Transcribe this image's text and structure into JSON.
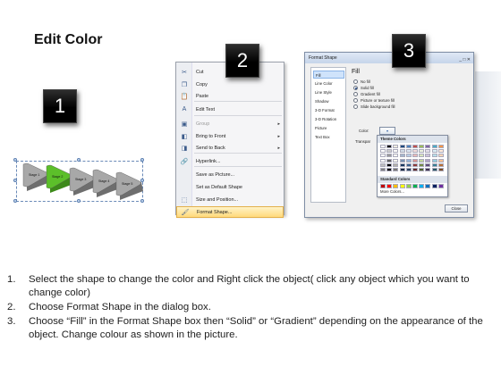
{
  "title": "Edit Color",
  "badges": [
    "1",
    "2",
    "3"
  ],
  "stages": {
    "labels": [
      "Stage 1",
      "Stage 2",
      "Stage 3",
      "Stage 4",
      "Stage 5"
    ],
    "selected_color": "#5cbf2a",
    "base_color": "#a8a8a8"
  },
  "context_menu": {
    "items": [
      {
        "icon": "scissors-icon",
        "glyph": "✂",
        "label": "Cut"
      },
      {
        "icon": "copy-icon",
        "glyph": "❐",
        "label": "Copy"
      },
      {
        "icon": "paste-icon",
        "glyph": "📋",
        "label": "Paste"
      },
      {
        "icon": "edit-text-icon",
        "glyph": "A",
        "label": "Edit Text"
      },
      {
        "icon": "group-icon",
        "glyph": "▣",
        "label": "Group"
      },
      {
        "icon": "bring-to-front-icon",
        "glyph": "◧",
        "label": "Bring to Front"
      },
      {
        "icon": "send-to-back-icon",
        "glyph": "◨",
        "label": "Send to Back"
      },
      {
        "icon": "hyperlink-icon",
        "glyph": "🔗",
        "label": "Hyperlink..."
      },
      {
        "icon": "save-as-picture-icon",
        "glyph": "",
        "label": "Save as Picture..."
      },
      {
        "icon": "default-shape-icon",
        "glyph": "",
        "label": "Set as Default Shape"
      },
      {
        "icon": "size-position-icon",
        "glyph": "⬚",
        "label": "Size and Position..."
      },
      {
        "icon": "format-shape-icon",
        "glyph": "🖌",
        "label": "Format Shape..."
      }
    ]
  },
  "dialog": {
    "title": "Format Shape",
    "nav": [
      "Fill",
      "Line Color",
      "Line Style",
      "Shadow",
      "3-D Format",
      "3-D Rotation",
      "Picture",
      "Text Box"
    ],
    "section_title": "Fill",
    "options": [
      "No fill",
      "Solid fill",
      "Gradient fill",
      "Picture or texture fill",
      "Slide background fill"
    ],
    "selected_option": "Solid fill",
    "color_label": "Color:",
    "transparency_label": "Transpar",
    "theme_colors_label": "Theme Colors",
    "standard_colors_label": "Standard Colors",
    "more_colors_label": "More Colors...",
    "close_label": "Close",
    "window_buttons": "_ □ ✕",
    "theme_colors": [
      "#ffffff",
      "#000000",
      "#eeece1",
      "#1f497d",
      "#4f81bd",
      "#c0504d",
      "#9bbb59",
      "#8064a2",
      "#4bacc6",
      "#f79646"
    ],
    "standard_colors": [
      "#c00000",
      "#ff0000",
      "#ffc000",
      "#ffff00",
      "#92d050",
      "#00b050",
      "#00b0f0",
      "#0070c0",
      "#002060",
      "#7030a0"
    ]
  },
  "instructions": [
    {
      "num": "1.",
      "text": "Select the shape to change the color and Right click the object( click any object which you want to change color)"
    },
    {
      "num": "2.",
      "text": "Choose Format Shape in the dialog box."
    },
    {
      "num": "3.",
      "text": "Choose “Fill” in the Format Shape box then “Solid” or “Gradient” depending on the appearance of the object. Change colour as shown in the picture."
    }
  ]
}
